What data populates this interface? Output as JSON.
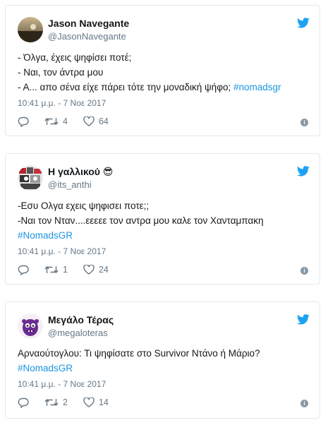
{
  "tweets": [
    {
      "author_name": "Jason Navegante",
      "handle": "@JasonNavegante",
      "lines": [
        "- Όλγα, έχεις ψηφίσει ποτέ;",
        "- Ναι, τον άντρα μου",
        "- Α... απο σένα είχε πάρει τότε την μοναδική ψήφο;"
      ],
      "hashtag": "#nomadsgr",
      "timestamp": "10:41 μ.μ. - 7 Νοε 2017",
      "retweets": "4",
      "likes": "64"
    },
    {
      "author_name": "Η γαλλικού",
      "emoji": "😎",
      "handle": "@its_anthi",
      "lines": [
        "-Εσυ Ολγα εχεις ψηφισει ποτε;;",
        "-Ναι τον Νταν....εεεεε τον αντρα μου καλε τον Χανταμπακη"
      ],
      "hashtag": "#NomadsGR",
      "timestamp": "10:41 μ.μ. - 7 Νοε 2017",
      "retweets": "1",
      "likes": "24"
    },
    {
      "author_name": "Μεγάλο Τέρας",
      "handle": "@megaloteras",
      "lines": [
        "Αρναούτογλου: Τι ψηφίσατε στο Survivor Ντάνο ή Μάριο?"
      ],
      "hashtag": "#NomadsGR",
      "timestamp": "10:41 μ.μ. - 7 Νοε 2017",
      "retweets": "2",
      "likes": "14"
    }
  ],
  "colors": {
    "link": "#1b95e0",
    "muted": "#657786",
    "border": "#e1e8ed"
  },
  "icons": [
    "twitter-bird-icon",
    "reply-icon",
    "retweet-icon",
    "like-icon",
    "info-icon"
  ]
}
